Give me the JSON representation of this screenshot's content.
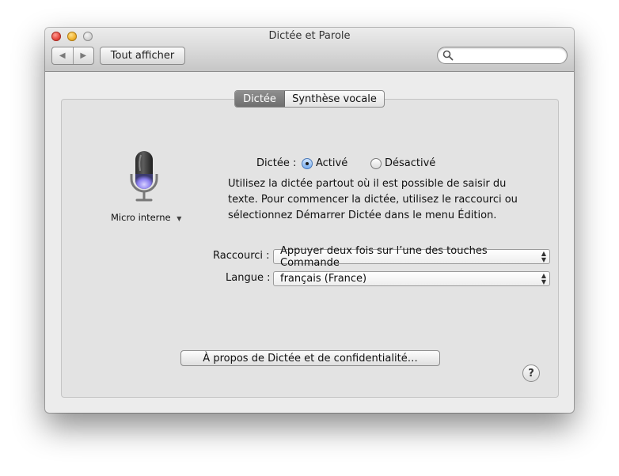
{
  "window": {
    "title": "Dictée et Parole"
  },
  "toolbar": {
    "back_icon": "back-arrow-icon",
    "forward_icon": "forward-arrow-icon",
    "back_glyph": "◀",
    "forward_glyph": "▶",
    "show_all_label": "Tout afficher",
    "search_placeholder": "",
    "search_value": ""
  },
  "tabs": [
    {
      "label": "Dictée",
      "selected": true
    },
    {
      "label": "Synthèse vocale",
      "selected": false
    }
  ],
  "microphone": {
    "icon": "microphone-icon",
    "label": "Micro interne",
    "dropdown_glyph": "▼"
  },
  "dictation": {
    "label": "Dictée :",
    "options": [
      {
        "label": "Activé",
        "selected": true
      },
      {
        "label": "Désactivé",
        "selected": false
      }
    ],
    "description_lines": [
      "Utilisez la dictée partout où il est possible de saisir du",
      "texte. Pour commencer la dictée, utilisez le raccourci ou",
      "sélectionnez Démarrer Dictée dans le menu Édition."
    ]
  },
  "shortcut": {
    "label": "Raccourci :",
    "value": "Appuyer deux fois sur l’une des touches Commande"
  },
  "language": {
    "label": "Langue :",
    "value": "français (France)"
  },
  "about_button": {
    "label": "À propos de Dictée et de confidentialité…"
  },
  "help_button": {
    "label": "?"
  },
  "colors": {
    "window_bg": "#ececec",
    "panel_bg": "#e3e3e3",
    "selected_tab": "#7a7a7a",
    "radio_selected": "#79aef0"
  }
}
